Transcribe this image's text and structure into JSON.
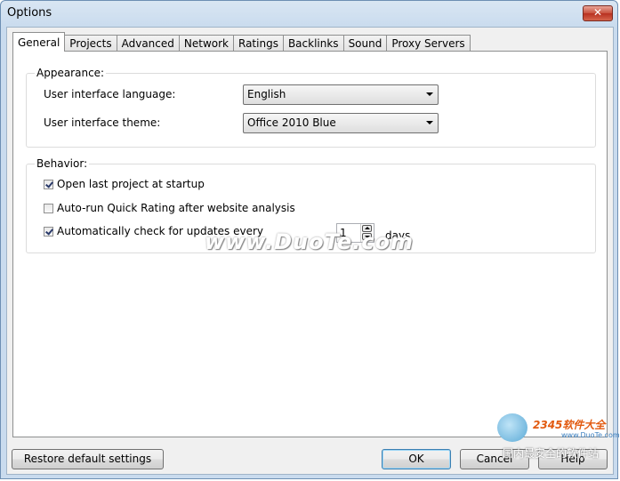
{
  "window": {
    "title": "Options",
    "close_label": "✕"
  },
  "tabs": [
    "General",
    "Projects",
    "Advanced",
    "Network",
    "Ratings",
    "Backlinks",
    "Sound",
    "Proxy Servers"
  ],
  "appearance": {
    "label": "Appearance:",
    "language_label": "User interface language:",
    "language_value": "English",
    "theme_label": "User interface theme:",
    "theme_value": "Office 2010 Blue"
  },
  "behavior": {
    "label": "Behavior:",
    "open_last": {
      "label": "Open last project at startup",
      "checked": true
    },
    "auto_rating": {
      "label": "Auto-run Quick Rating after website analysis",
      "checked": false
    },
    "auto_update": {
      "label": "Automatically check for updates every",
      "checked": true,
      "value": "1",
      "unit": "days"
    }
  },
  "buttons": {
    "restore": "Restore default settings",
    "ok": "OK",
    "cancel": "Cancel",
    "help": "Help"
  },
  "watermark": {
    "text": "www.DuoTe.com"
  },
  "logo": {
    "top": "2345软件大全",
    "url": "www.DuoTe.com",
    "bottom": "国内最安全的软件站"
  }
}
